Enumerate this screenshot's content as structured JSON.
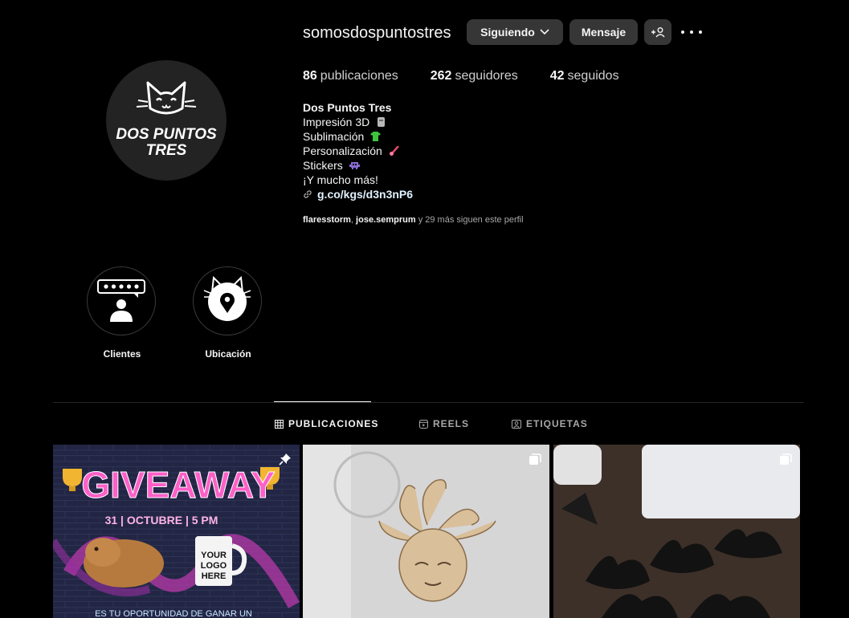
{
  "profile": {
    "username": "somosdospuntostres",
    "following_label": "Siguiendo",
    "message_label": "Mensaje",
    "stats": {
      "posts_count": "86",
      "posts_label": "publicaciones",
      "followers_count": "262",
      "followers_label": "seguidores",
      "following_count": "42",
      "following_label": "seguidos"
    },
    "bio": {
      "name": "Dos Puntos Tres",
      "lines": [
        "Impresión 3D",
        "Sublimación",
        "Personalización",
        "Stickers",
        "¡Y mucho más!"
      ],
      "link": "g.co/kgs/d3n3nP6"
    },
    "followed_by": {
      "user1": "flaresstorm",
      "user2": "jose.semprum",
      "rest": "y 29 más siguen este perfil"
    },
    "avatar_text_line1": "DOS PUNTOS",
    "avatar_text_line2": "TRES"
  },
  "highlights": [
    {
      "label": "Clientes",
      "icon": "review-stars-icon"
    },
    {
      "label": "Ubicación",
      "icon": "location-pin-icon"
    }
  ],
  "tabs": [
    {
      "label": "PUBLICACIONES",
      "active": true,
      "icon": "grid-icon"
    },
    {
      "label": "REELS",
      "active": false,
      "icon": "reels-icon"
    },
    {
      "label": "ETIQUETAS",
      "active": false,
      "icon": "tagged-icon"
    }
  ],
  "posts": [
    {
      "badge": "pin-icon",
      "title": "GIVEAWAY",
      "subtitle": "31 | OCTUBRE | 5 PM",
      "mug_text_1": "YOUR",
      "mug_text_2": "LOGO",
      "mug_text_3": "HERE",
      "footer": "ES TU OPORTUNIDAD DE GANAR UN"
    },
    {
      "badge": "carousel-icon"
    },
    {
      "badge": "carousel-icon"
    }
  ],
  "colors": {
    "background": "#000000",
    "button": "#363636",
    "link": "#e0f1ff",
    "muted": "#a8a8a8",
    "giveaway_pink": "#ff5fc8"
  }
}
